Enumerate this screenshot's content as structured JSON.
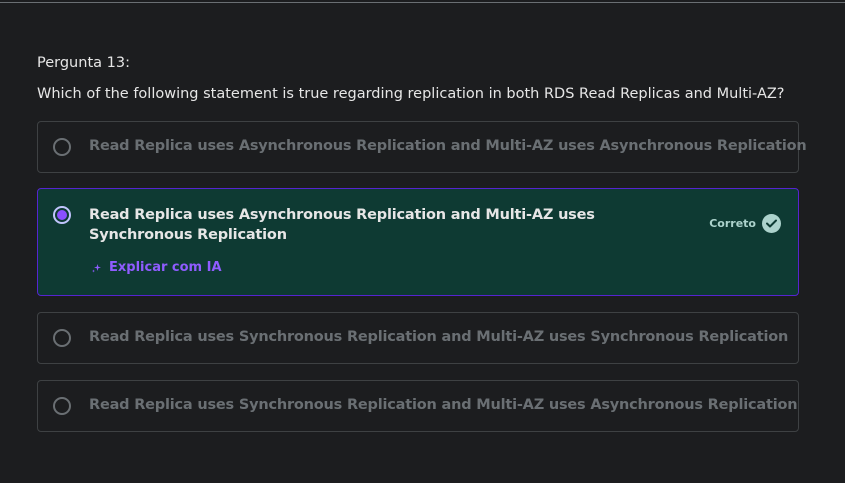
{
  "question": {
    "label": "Pergunta 13:",
    "text": "Which of the following statement is true regarding replication in both RDS Read Replicas and Multi-AZ?"
  },
  "options": [
    {
      "text": "Read Replica uses Asynchronous Replication and Multi-AZ uses Asynchronous Replication",
      "selected": false
    },
    {
      "text": "Read Replica uses Asynchronous Replication and Multi-AZ uses Synchronous Replication",
      "selected": true
    },
    {
      "text": "Read Replica uses Synchronous Replication and Multi-AZ uses Synchronous Replication",
      "selected": false
    },
    {
      "text": "Read Replica uses Synchronous Replication and Multi-AZ uses Asynchronous Replication",
      "selected": false
    }
  ],
  "feedback": {
    "correct_label": "Correto",
    "explain_ai_label": "Explicar com IA"
  },
  "colors": {
    "background": "#1c1d1f",
    "selected_bg": "#0e3a33",
    "selected_border": "#5624d0",
    "accent_purple": "#8f5cff",
    "correct_green": "#acd2cc"
  },
  "icons": [
    "radio-empty-icon",
    "radio-selected-icon",
    "check-circle-icon",
    "sparkle-icon"
  ]
}
